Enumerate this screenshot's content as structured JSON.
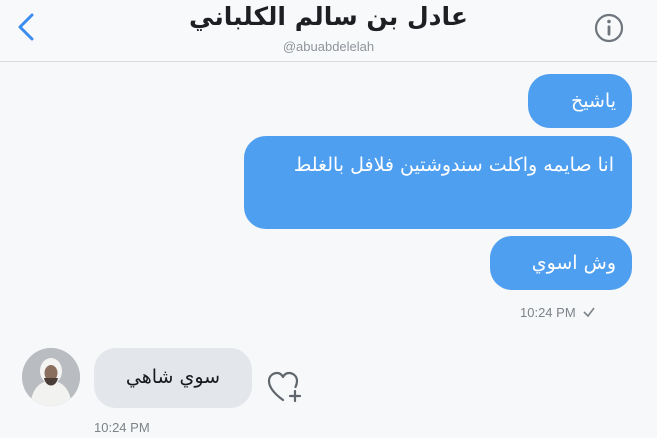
{
  "header": {
    "back_icon": "chevron-left-icon",
    "title": "عادل بن سالم الكلباني",
    "handle": "@abuabdelelah",
    "info_icon": "info-circle-icon"
  },
  "messages": {
    "outgoing": [
      {
        "text": "ياشيخ"
      },
      {
        "text": "انا صايمه واكلت سندوشتين فلافل بالغلط"
      },
      {
        "text": "وش اسوي"
      }
    ],
    "outgoing_time": "10:24 PM",
    "incoming": {
      "text": "سوي شاهي",
      "time": "10:24 PM"
    }
  },
  "colors": {
    "accent": "#4f9ff0",
    "incoming_bubble": "#e3e6ea"
  }
}
